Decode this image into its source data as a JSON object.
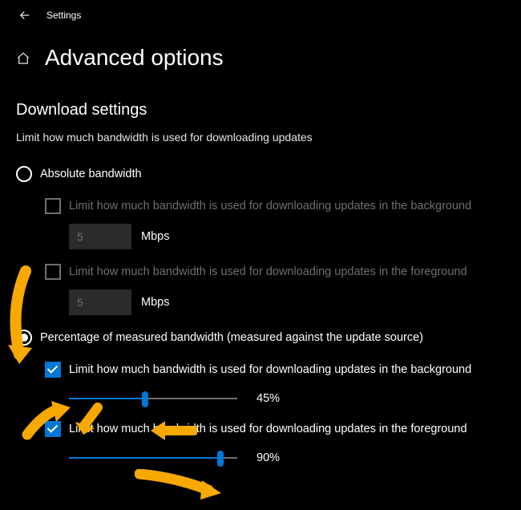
{
  "app_title": "Settings",
  "page_title": "Advanced options",
  "section_title": "Download settings",
  "section_desc": "Limit how much bandwidth is used for downloading updates",
  "absolute": {
    "label": "Absolute bandwidth",
    "bg_check_label": "Limit how much bandwidth is used for downloading updates in the background",
    "bg_value": "5",
    "bg_unit": "Mbps",
    "fg_check_label": "Limit how much bandwidth is used for downloading updates in the foreground",
    "fg_value": "5",
    "fg_unit": "Mbps"
  },
  "percentage": {
    "label": "Percentage of measured bandwidth (measured against the update source)",
    "bg_check_label": "Limit how much bandwidth is used for downloading updates in the background",
    "bg_pct": "45%",
    "bg_fill": "45%",
    "fg_check_label": "Limit how much bandwidth is used for downloading updates in the foreground",
    "fg_pct": "90%",
    "fg_fill": "90%"
  }
}
